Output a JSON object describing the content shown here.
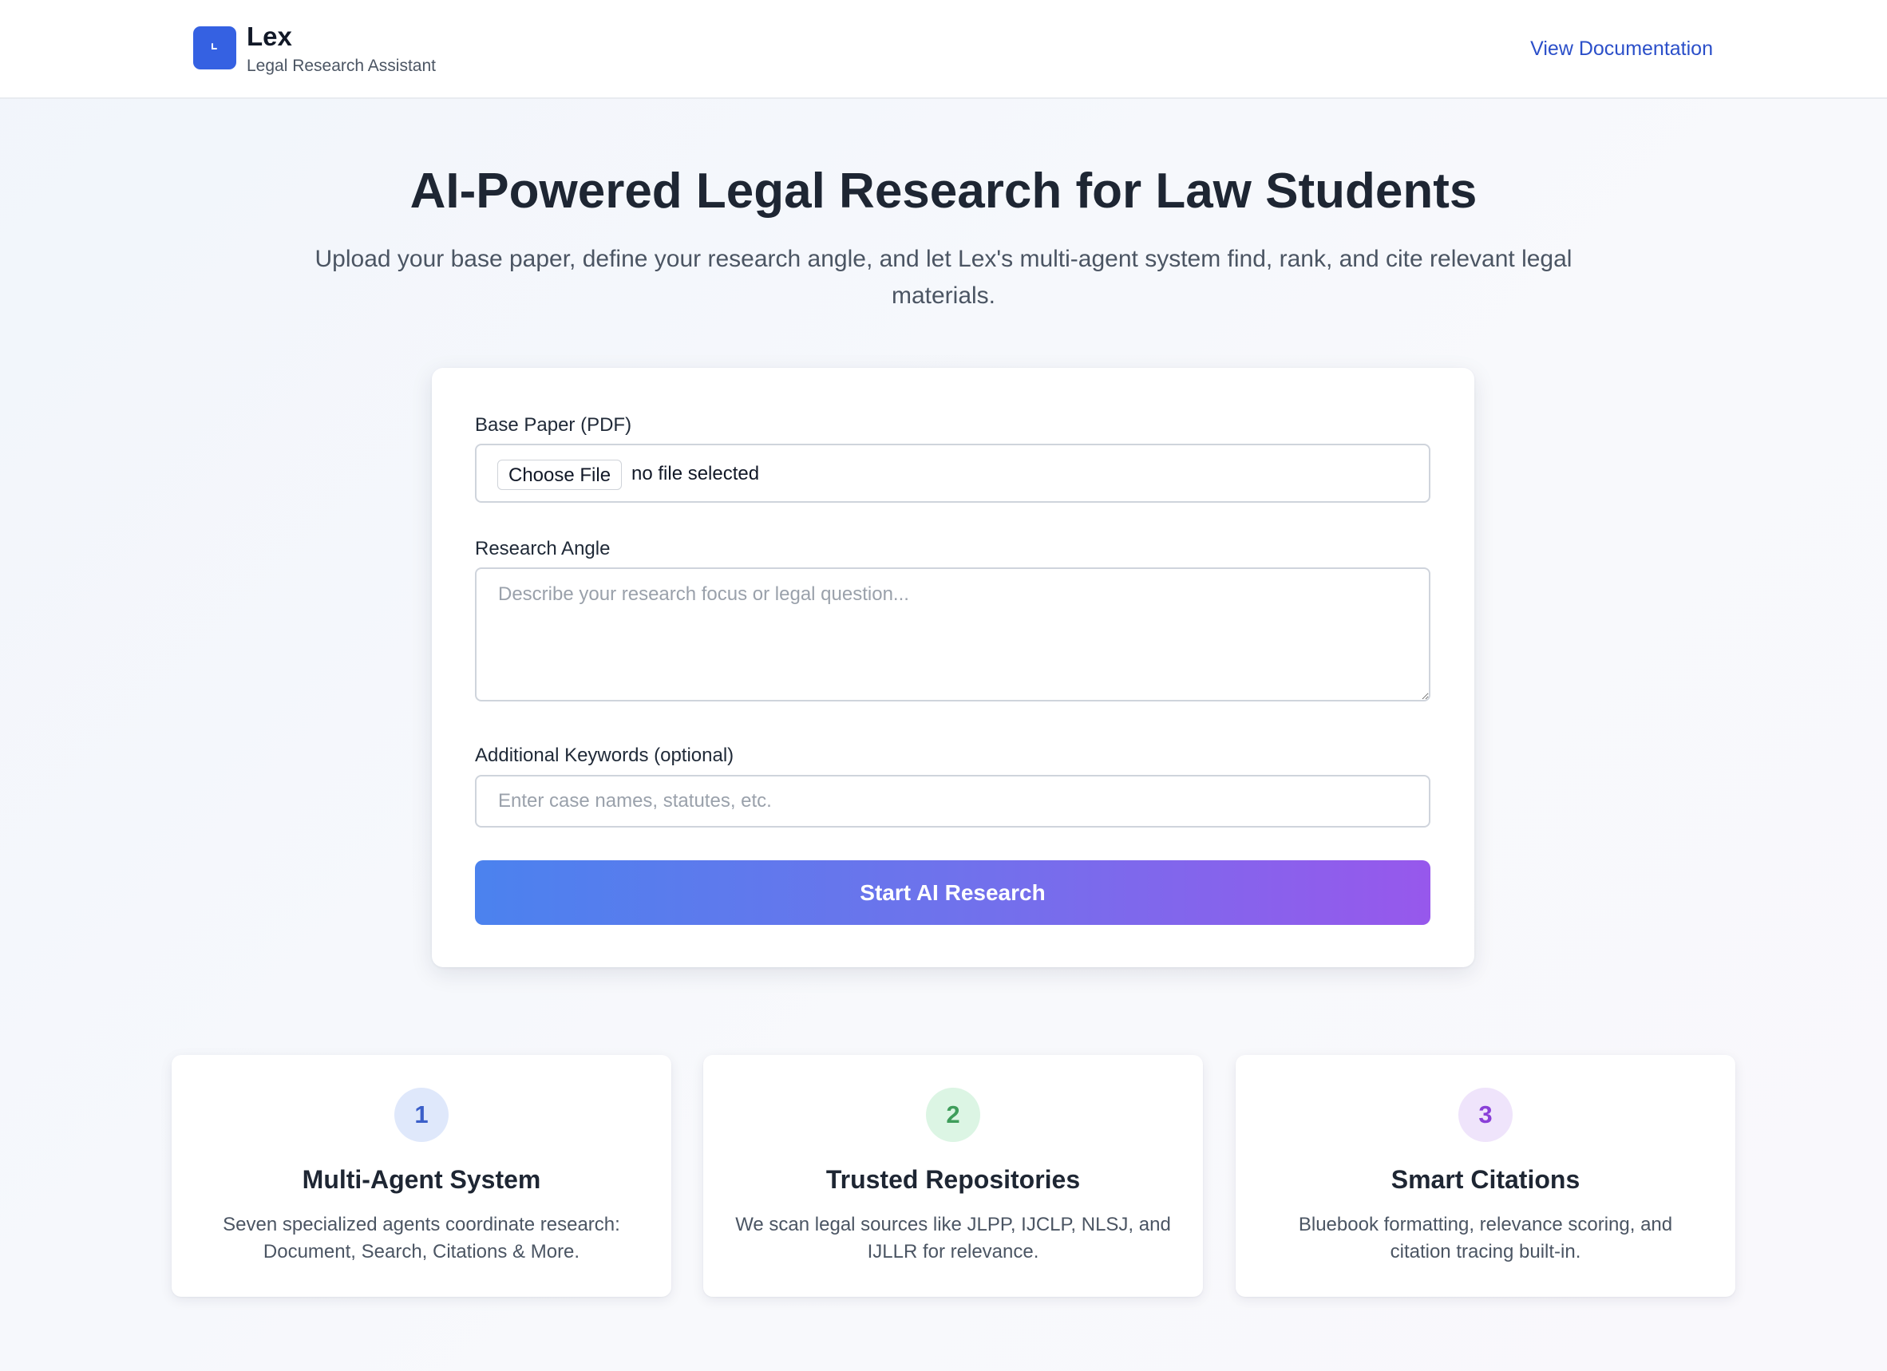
{
  "header": {
    "brand_name": "Lex",
    "brand_subtitle": "Legal Research Assistant",
    "doc_link": "View Documentation",
    "logo_icon": "clock-icon"
  },
  "hero": {
    "title": "AI-Powered Legal Research for Law Students",
    "subtitle": "Upload your base paper, define your research angle, and let Lex's multi-agent system find, rank, and cite relevant legal materials."
  },
  "form": {
    "base_paper_label": "Base Paper (PDF)",
    "choose_file_label": "Choose File",
    "file_status": "no file selected",
    "research_angle_label": "Research Angle",
    "research_angle_placeholder": "Describe your research focus or legal question...",
    "keywords_label": "Additional Keywords (optional)",
    "keywords_placeholder": "Enter case names, statutes, etc.",
    "submit_label": "Start AI Research"
  },
  "features": [
    {
      "number": "1",
      "title": "Multi-Agent System",
      "description": "Seven specialized agents coordinate research: Document, Search, Citations & More.",
      "badge_bg": "#dfe8fb",
      "badge_color": "#3b5fc9"
    },
    {
      "number": "2",
      "title": "Trusted Repositories",
      "description": "We scan legal sources like JLPP, IJCLP, NLSJ, and IJLLR for relevance.",
      "badge_bg": "#dcf5e4",
      "badge_color": "#3f9d5b"
    },
    {
      "number": "3",
      "title": "Smart Citations",
      "description": "Bluebook formatting, relevance scoring, and citation tracing built-in.",
      "badge_bg": "#efe4fb",
      "badge_color": "#8a3fd8"
    }
  ],
  "colors": {
    "accent": "#3561e2",
    "link": "#2b4fc9",
    "button_gradient_start": "#4b82ee",
    "button_gradient_end": "#9758ec"
  }
}
